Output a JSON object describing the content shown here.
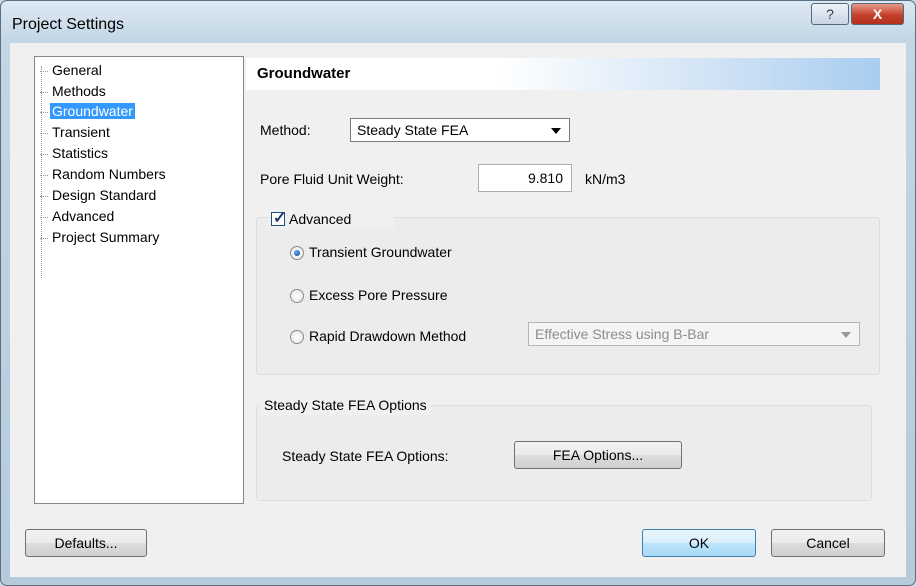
{
  "window": {
    "title": "Project Settings",
    "help_label": "?",
    "close_label": "X"
  },
  "tree": {
    "items": [
      "General",
      "Methods",
      "Groundwater",
      "Transient",
      "Statistics",
      "Random Numbers",
      "Design Standard",
      "Advanced",
      "Project Summary"
    ],
    "selected": "Groundwater"
  },
  "panel": {
    "header": "Groundwater",
    "method_label": "Method:",
    "method_value": "Steady State FEA",
    "unit_weight_label": "Pore Fluid Unit Weight:",
    "unit_weight_value": "9.810",
    "unit_weight_unit": "kN/m3",
    "advanced": {
      "label": "Advanced",
      "checked": true,
      "options": [
        "Transient Groundwater",
        "Excess Pore Pressure",
        "Rapid Drawdown Method"
      ],
      "selected": "Transient Groundwater",
      "drawdown_combo_value": "Effective Stress using B-Bar"
    },
    "fea_group": {
      "caption": "Steady State FEA Options",
      "row_label": "Steady State FEA Options:",
      "button_label": "FEA Options..."
    }
  },
  "footer": {
    "defaults_label": "Defaults...",
    "ok_label": "OK",
    "cancel_label": "Cancel"
  },
  "colors": {
    "selection": "#3399ff",
    "header_gradient_end": "#a9cdf0",
    "close_button": "#c4412b"
  }
}
